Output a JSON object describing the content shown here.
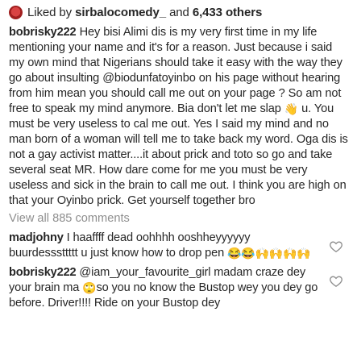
{
  "likes": {
    "prefix": "Liked by",
    "user": "sirbalocomedy_",
    "and": "and",
    "count": "6,433 others"
  },
  "caption": {
    "user": "bobrisky222",
    "text_part1": " Hey bisi Alimi dis is my very first time in my life mentioning your name and it's for a reason. Just because i said my own mind that Nigerians should take it easy with the way they go about insulting @biodunfatoyinbo on his page without hearing from him mean you should call me out on your page ? So am not free to speak my mind anymore. Bia don't let me slap ",
    "emoji": "👋",
    "text_part2": " u. You must be very useless to cal me out. Yes I said my mind and no man born of a woman will tell me to take back my word. Oga dis is not a gay activist matter....it about prick and toto so go and take several seat MR. How dare come for me you must be very useless and sick in the brain to call me out. I think you are high on that your Oyinbo prick. Get yourself together bro"
  },
  "view_all": "View all 885 comments",
  "comments": [
    {
      "user": "madjohny",
      "text": " I haaffff dead oohhhh ooshheyyyyyy buurdesssttttt u just know how to drop pen ",
      "emojis": "😂😂🙌🙌🙌🙌"
    },
    {
      "user": "bobrisky222",
      "mention": " @iam_your_favourite_girl",
      "text1": " madam craze dey your brain ma ",
      "emoji": "🙄",
      "text2": "so you no know the Bustop wey you dey go before. Driver!!!! Ride on your Bustop dey"
    }
  ],
  "icons": {
    "heart": "heart-outline-icon",
    "avatar_color": "#c62828",
    "muted_text_color": "#8e8e8e"
  }
}
